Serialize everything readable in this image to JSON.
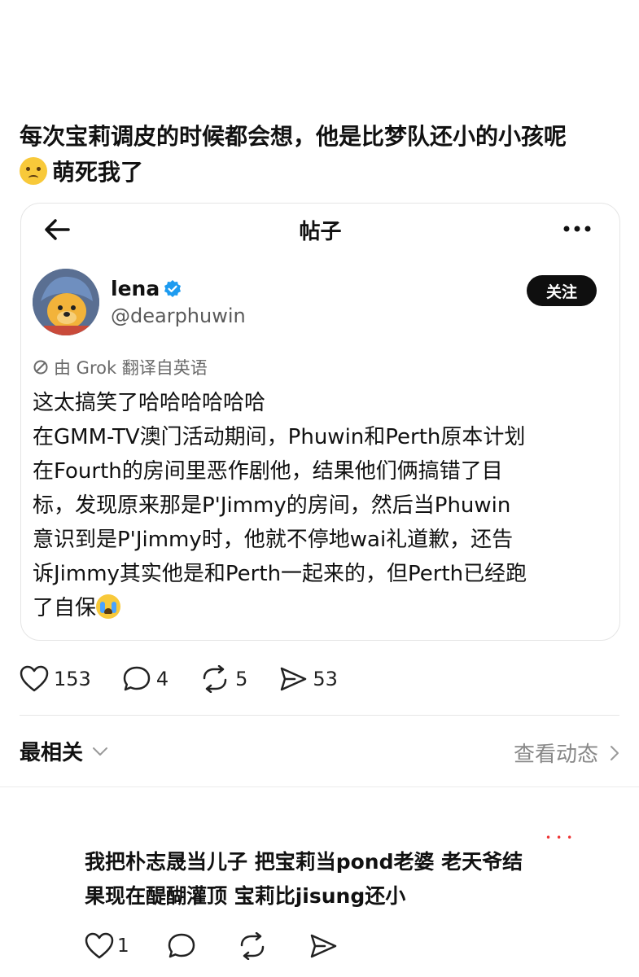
{
  "post": {
    "line1": "每次宝莉调皮的时候都会想，他是比梦队还小的小孩呢",
    "line2": "萌死我了"
  },
  "card": {
    "title": "帖子",
    "user": {
      "name": "lena",
      "handle": "@dearphuwin"
    },
    "follow_label": "关注",
    "translate_note": "由 Grok 翻译自英语",
    "body_lines": [
      "这太搞笑了哈哈哈哈哈哈",
      "在GMM-TV澳门活动期间，Phuwin和Perth原本计划",
      "在Fourth的房间里恶作剧他，结果他们俩搞错了目",
      "标，发现原来那是P'Jimmy的房间，然后当Phuwin",
      "意识到是P'Jimmy时，他就不停地wai礼道歉，还告",
      "诉Jimmy其实他是和Perth一起来的，但Perth已经跑",
      "了自保"
    ]
  },
  "stats": {
    "likes": "153",
    "comments": "4",
    "reposts": "5",
    "shares": "53"
  },
  "sort": {
    "label": "最相关",
    "view_activity": "查看动态"
  },
  "reply": {
    "line1": "我把朴志晟当儿子 把宝莉当pond老婆 老天爷结",
    "line2": "果现在醍醐灌顶 宝莉比jisung还小",
    "likes": "1"
  }
}
